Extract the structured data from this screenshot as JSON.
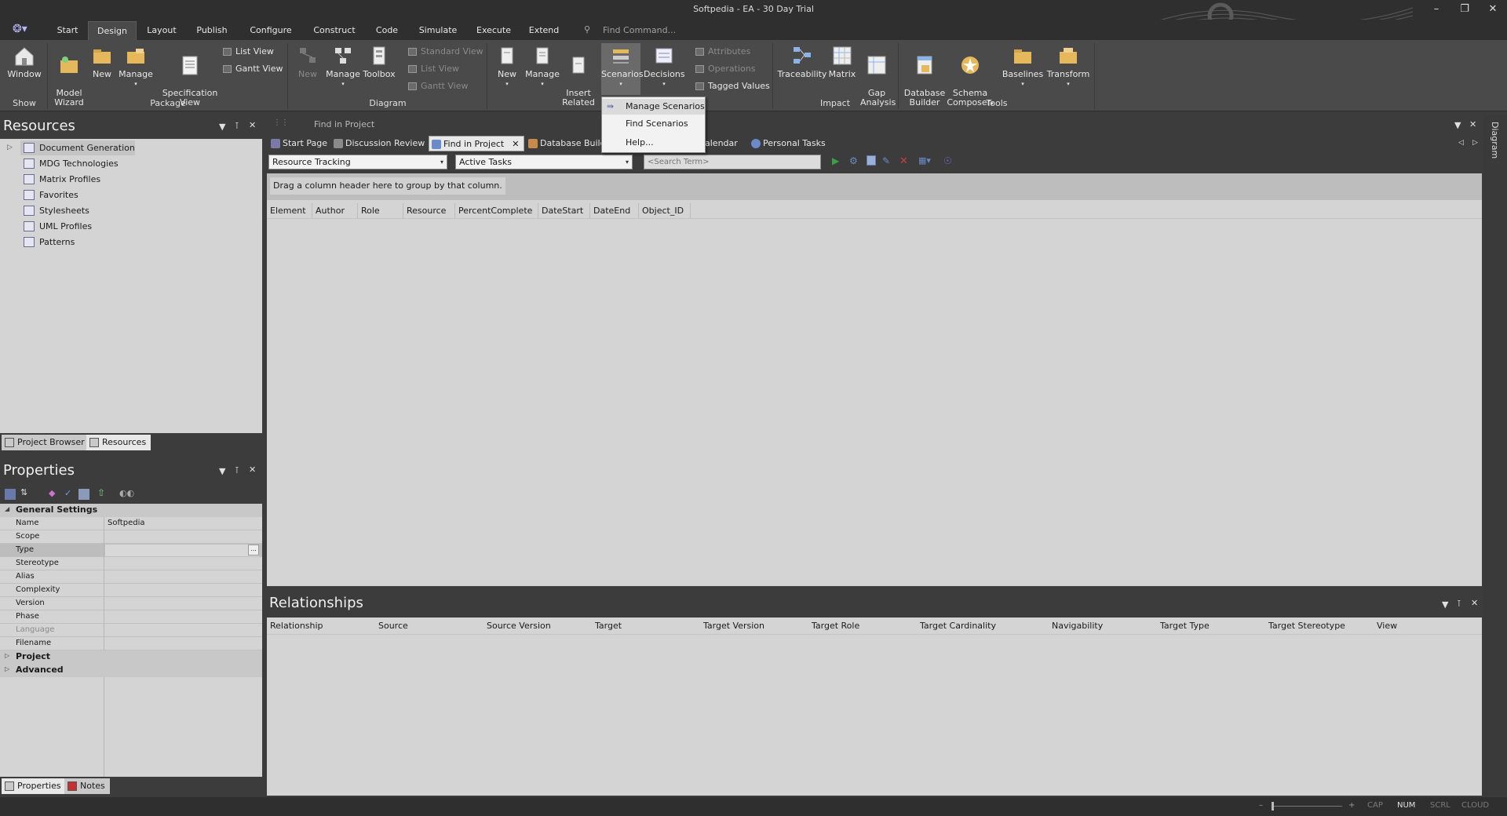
{
  "window": {
    "title": "Softpedia - EA - 30 Day Trial"
  },
  "menu": {
    "tabs": [
      "Start",
      "Design",
      "Layout",
      "Publish",
      "Configure",
      "Construct",
      "Code",
      "Simulate",
      "Execute",
      "Extend"
    ],
    "active": "Design",
    "find_command": "Find Command..."
  },
  "ribbon": {
    "show": {
      "window": "Window",
      "group": "Show"
    },
    "package": {
      "model_wizard": "Model\nWizard",
      "new": "New",
      "manage": "Manage",
      "spec_view": "Specification\nView",
      "list_view": "List View",
      "gantt_view": "Gantt View",
      "group": "Package"
    },
    "diagram": {
      "new": "New",
      "manage": "Manage",
      "toolbox": "Toolbox",
      "standard_view": "Standard View",
      "list_view": "List View",
      "gantt_view": "Gantt View",
      "group": "Diagram"
    },
    "element": {
      "new": "New",
      "manage": "Manage",
      "insert_related": "Insert\nRelated",
      "scenarios": "Scenarios",
      "decisions": "Decisions",
      "attributes": "Attributes",
      "operations": "Operations",
      "tagged_values": "Tagged Values"
    },
    "impact": {
      "traceability": "Traceability",
      "matrix": "Matrix",
      "gap_analysis": "Gap\nAnalysis",
      "group": "Impact"
    },
    "tools": {
      "database_builder": "Database\nBuilder",
      "schema_composer": "Schema\nComposer",
      "baselines": "Baselines",
      "transform": "Transform",
      "group": "Tools"
    }
  },
  "scenarios_menu": {
    "items": [
      "Manage Scenarios",
      "Find Scenarios",
      "Help..."
    ]
  },
  "resources": {
    "title": "Resources",
    "items": [
      "Document Generation",
      "MDG Technologies",
      "Matrix Profiles",
      "Favorites",
      "Stylesheets",
      "UML Profiles",
      "Patterns"
    ],
    "bottom_tabs": [
      "Project Browser",
      "Resources"
    ]
  },
  "properties": {
    "title": "Properties",
    "general": "General Settings",
    "rows": [
      {
        "key": "Name",
        "value": "Softpedia"
      },
      {
        "key": "Scope",
        "value": ""
      },
      {
        "key": "Type",
        "value": ""
      },
      {
        "key": "Stereotype",
        "value": ""
      },
      {
        "key": "Alias",
        "value": ""
      },
      {
        "key": "Complexity",
        "value": ""
      },
      {
        "key": "Version",
        "value": ""
      },
      {
        "key": "Phase",
        "value": ""
      },
      {
        "key": "Language",
        "value": ""
      },
      {
        "key": "Filename",
        "value": ""
      }
    ],
    "categories": [
      "Project",
      "Advanced"
    ],
    "bottom_tabs": [
      "Properties",
      "Notes"
    ],
    "type_btn": "..."
  },
  "main": {
    "panel_caption": "Find in Project",
    "tabs": [
      "Start Page",
      "Discussion Review",
      "Find in Project",
      "Database Builder",
      "Calendar",
      "Personal Tasks"
    ],
    "tab_fragments": {
      "database": "Database Builc",
      "calendar": "alendar"
    },
    "combo1": "Resource Tracking",
    "combo2": "Active Tasks",
    "search_placeholder": "<Search Term>",
    "group_hint": "Drag a column header here to group by that column.",
    "columns": [
      "Element",
      "Author",
      "Role",
      "Resource",
      "PercentComplete",
      "DateStart",
      "DateEnd",
      "Object_ID"
    ]
  },
  "relationships": {
    "title": "Relationships",
    "columns": [
      "Relationship",
      "Source",
      "Source Version",
      "Target",
      "Target Version",
      "Target Role",
      "Target Cardinality",
      "Navigability",
      "Target Type",
      "Target Stereotype",
      "View"
    ]
  },
  "right_strip": {
    "label": "Diagram"
  },
  "status": {
    "cap": "CAP",
    "num": "NUM",
    "scrl": "SCRL",
    "cloud": "CLOUD",
    "minus": "–",
    "plus": "+"
  },
  "colors": {
    "chrome": "#2f2f2f",
    "ribbon": "#4a4a4a",
    "panel": "#d4d4d4"
  }
}
